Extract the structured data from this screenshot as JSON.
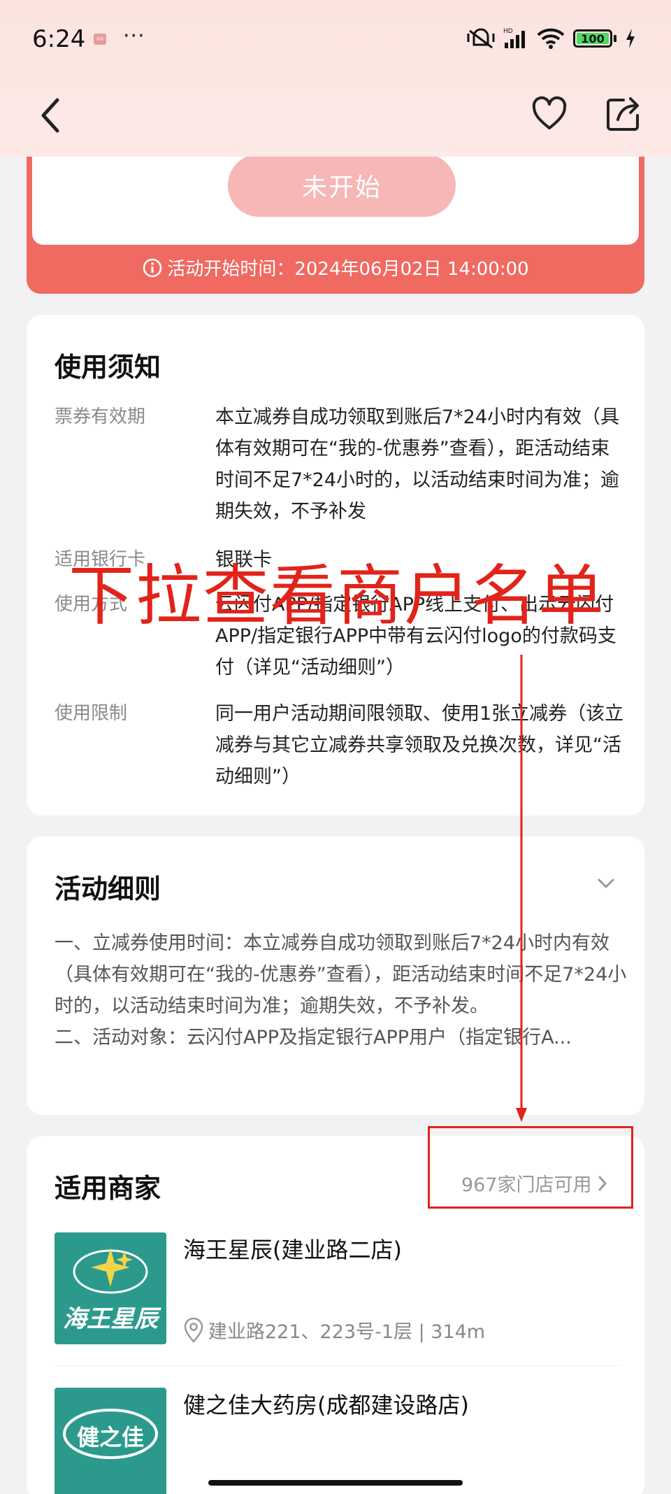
{
  "status_bar": {
    "time": "6:24",
    "dots": "···",
    "battery": "100"
  },
  "coupon": {
    "button_label": "未开始",
    "start_time": "活动开始时间：2024年06月02日 14:00:00"
  },
  "usage_notes": {
    "title": "使用须知",
    "rows": [
      {
        "label": "票券有效期",
        "text": "本立减券自成功领取到账后7*24小时内有效（具体有效期可在“我的-优惠券”查看），距活动结束时间不足7*24小时的，以活动结束时间为准；逾期失效，不予补发"
      },
      {
        "label": "适用银行卡",
        "text": "银联卡"
      },
      {
        "label": "使用方式",
        "text": "云闪付APP/指定银行APP线上支付、出示云闪付APP/指定银行APP中带有云闪付logo的付款码支付（详见“活动细则”）"
      },
      {
        "label": "使用限制",
        "text": "同一用户活动期间限领取、使用1张立减券（该立减券与其它立减券共享领取及兑换次数，详见“活动细则”）"
      }
    ]
  },
  "activity_rules": {
    "title": "活动细则",
    "line1": "一、立减券使用时间：本立减券自成功领取到账后7*24小时内有效（具体有效期可在“我的-优惠券”查看），距活动结束时间不足7*24小时的，以活动结束时间为准；逾期失效，不予补发。",
    "line2": "二、活动对象：云闪付APP及指定银行APP用户（指定银行A..."
  },
  "merchants": {
    "title": "适用商家",
    "stores_link": "967家门店可用",
    "items": [
      {
        "name": "海王星辰(建业路二店)",
        "address": "建业路221、223号-1层 | 314m",
        "logo_text": "海王星辰"
      },
      {
        "name": "健之佳大药房(成都建设路店)",
        "logo_text": "健之佳"
      }
    ]
  },
  "annotation": {
    "text": "下拉查看商户名单"
  },
  "colors": {
    "accent_red": "#f06a62",
    "button_pink": "#f6b7b6",
    "annotation_red": "#e2231a",
    "logo_teal": "#2b9a8c"
  }
}
